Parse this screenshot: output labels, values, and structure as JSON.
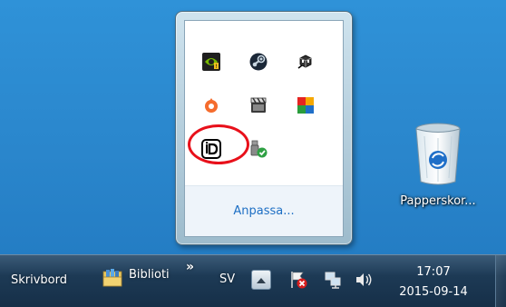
{
  "popup": {
    "customize_label": "Anpassa...",
    "icons": [
      {
        "name": "nvidia-icon"
      },
      {
        "name": "steam-icon"
      },
      {
        "name": "network-cube-icon"
      },
      {
        "name": "origin-icon"
      },
      {
        "name": "clapperboard-icon"
      },
      {
        "name": "avg-icon"
      },
      {
        "name": "idrive-icon"
      },
      {
        "name": "usb-safely-remove-icon"
      }
    ]
  },
  "desktop": {
    "recycle_bin_label": "Papperskor..."
  },
  "taskbar": {
    "desktop_toolbar_label": "Skrivbord",
    "libraries_label": "Biblioti",
    "overflow_chevron": "»",
    "language": "SV",
    "time": "17:07",
    "date": "2015-09-14"
  },
  "colors": {
    "highlight_ring": "#e8101a",
    "link": "#1e6fc4"
  }
}
